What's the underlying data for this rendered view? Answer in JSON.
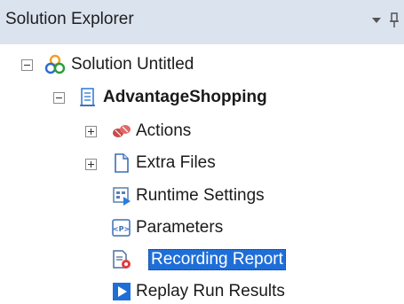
{
  "panel": {
    "title": "Solution Explorer",
    "dropdown_icon": "dropdown-triangle-icon",
    "pin_icon": "pin-icon"
  },
  "tree": {
    "solution": {
      "label": "Solution Untitled",
      "icon": "solution-icon",
      "expanded": true
    },
    "project": {
      "label": "AdvantageShopping",
      "icon": "test-document-icon",
      "expanded": true
    },
    "items": [
      {
        "label": "Actions",
        "icon": "actions-icon",
        "expander": "collapsed"
      },
      {
        "label": "Extra Files",
        "icon": "file-icon",
        "expander": "collapsed"
      },
      {
        "label": "Runtime Settings",
        "icon": "runtime-settings-icon"
      },
      {
        "label": "Parameters",
        "icon": "parameters-icon"
      },
      {
        "label": "Recording Report",
        "icon": "recording-report-icon",
        "selected": true
      },
      {
        "label": "Replay Run Results",
        "icon": "play-icon"
      }
    ]
  },
  "colors": {
    "titlebar_bg": "#dbe3ef",
    "selection_bg": "#1f6ed8",
    "selection_text": "#ffffff"
  }
}
